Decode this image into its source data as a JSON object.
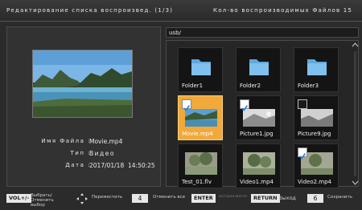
{
  "header": {
    "title": "Редактирование списка воспроизвед. (1/3)",
    "count_label": "Кол-во воспроизводимых Файлов 15"
  },
  "preview": {
    "filename_label": "Имя Файла :",
    "filename": "Movie.mp4",
    "type_label": "Тип :",
    "type": "Видео",
    "date_label": "Дата :",
    "date": "2017/01/18",
    "time": "14:50:25"
  },
  "path": "usb/",
  "files": [
    {
      "label": "Folder1",
      "kind": "folder",
      "checked": null,
      "selected": false
    },
    {
      "label": "Folder2",
      "kind": "folder",
      "checked": null,
      "selected": false
    },
    {
      "label": "Folder3",
      "kind": "folder",
      "checked": null,
      "selected": false
    },
    {
      "label": "Movie.mp4",
      "kind": "video",
      "checked": true,
      "selected": true
    },
    {
      "label": "Picture1.jpg",
      "kind": "picture",
      "checked": true,
      "selected": false
    },
    {
      "label": "Picture9.jpg",
      "kind": "picture",
      "checked": false,
      "selected": false
    },
    {
      "label": "Test_01.flv",
      "kind": "video",
      "checked": null,
      "selected": false
    },
    {
      "label": "Video1.mp4",
      "kind": "video",
      "checked": null,
      "selected": false
    },
    {
      "label": "Video2.mp4",
      "kind": "video",
      "checked": true,
      "selected": false
    }
  ],
  "footer": {
    "vol_key": "VOL+/-",
    "vol_text": "Выбрать/ Отменить выбор",
    "nav_text": "Переместить",
    "btn4": "4",
    "btn4_text": "Отменить все",
    "enter_key": "ENTER",
    "enter_text": "воспроизвести",
    "return_key": "RETURN",
    "return_text": "Выход",
    "btn6": "6",
    "btn6_text": "Сохранить"
  },
  "colors": {
    "selected": "#f0a93a",
    "folder": "#5fa8de",
    "check": "#2a7fd8"
  }
}
